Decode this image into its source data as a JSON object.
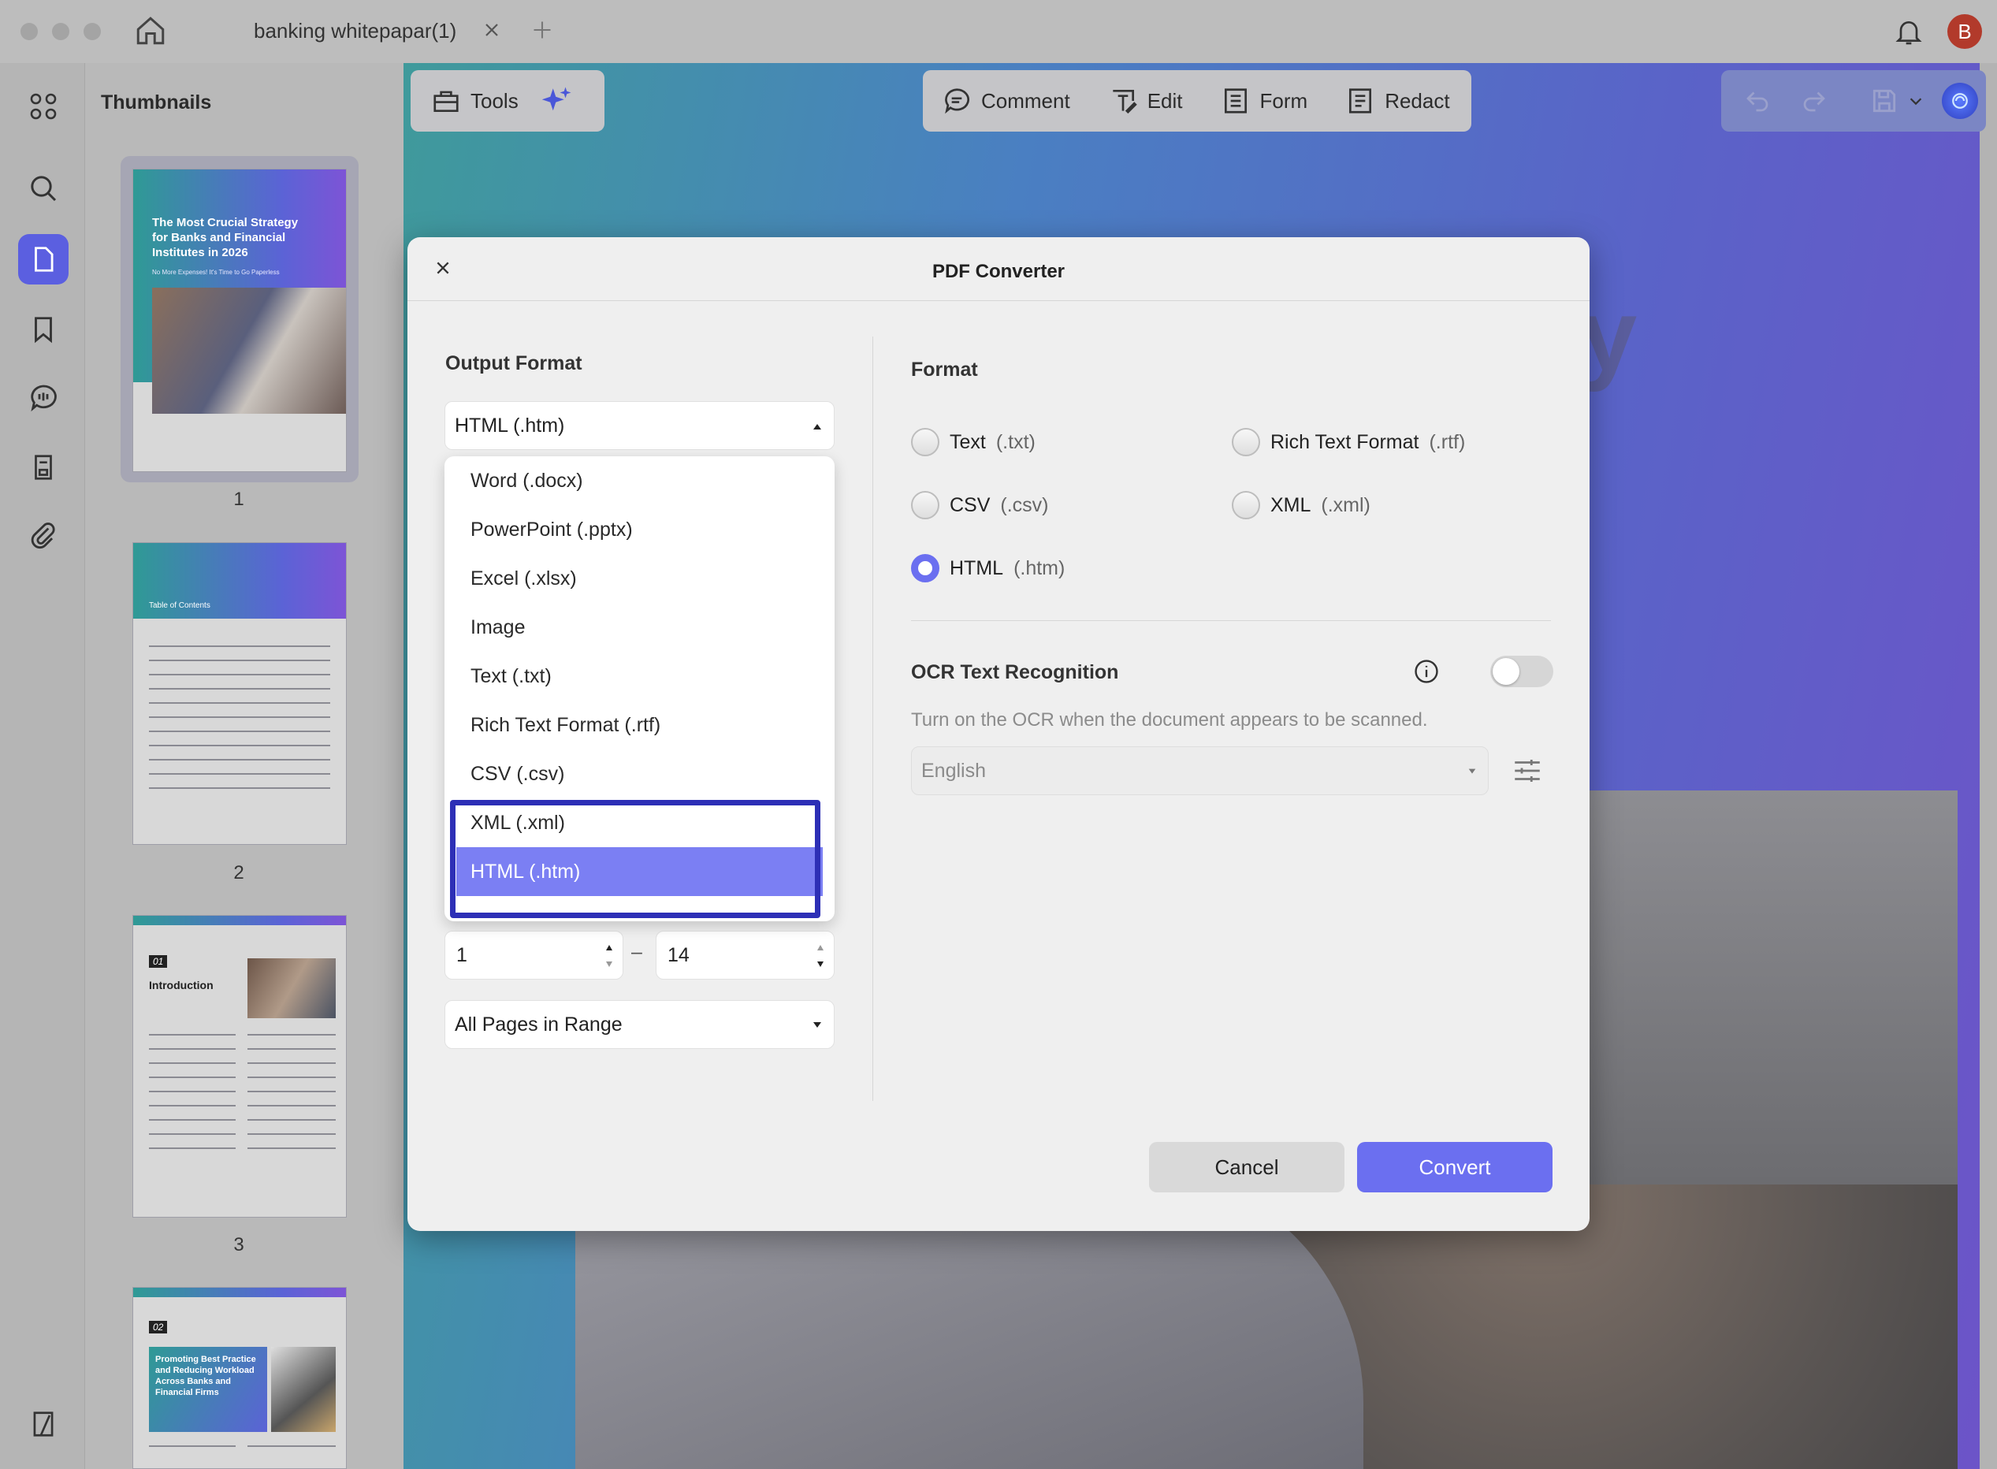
{
  "window": {
    "tab_title": "banking whitepapar(1)",
    "avatar_letter": "B",
    "accent": "#5b5fe0",
    "avatar_color": "#b23a2b"
  },
  "sidebar": {
    "panel_title": "Thumbnails",
    "icons": [
      "grid-icon",
      "search-icon",
      "page-icon",
      "bookmark-icon",
      "comment-icon",
      "form-icon",
      "attachment-icon"
    ],
    "bottom_icon": "sidebar-toggle-icon"
  },
  "thumbnails": [
    {
      "page": "1",
      "title": "The Most Crucial Strategy for Banks and Financial Institutes in 2026",
      "subtitle": "No More Expenses! It's Time to Go Paperless"
    },
    {
      "page": "2",
      "title": "Table of Contents"
    },
    {
      "page": "3",
      "chapter": "01",
      "title": "Introduction"
    },
    {
      "page": "",
      "chapter": "02",
      "title": "Promoting Best Practice and Reducing Workload Across Banks and Financial Firms"
    }
  ],
  "toolbar": {
    "tools_label": "Tools",
    "comment_label": "Comment",
    "edit_label": "Edit",
    "form_label": "Form",
    "redact_label": "Redact"
  },
  "page_bg_letter": "y",
  "dialog": {
    "title": "PDF Converter",
    "output_format_label": "Output Format",
    "output_format_value": "HTML (.htm)",
    "format_options": [
      {
        "label": "Word (.docx)",
        "selected": false
      },
      {
        "label": "PowerPoint (.pptx)",
        "selected": false
      },
      {
        "label": "Excel (.xlsx)",
        "selected": false
      },
      {
        "label": "Image",
        "selected": false
      },
      {
        "label": "Text (.txt)",
        "selected": false
      },
      {
        "label": "Rich Text Format (.rtf)",
        "selected": false
      },
      {
        "label": "CSV (.csv)",
        "selected": false
      },
      {
        "label": "XML (.xml)",
        "selected": false
      },
      {
        "label": "HTML (.htm)",
        "selected": true
      }
    ],
    "range_from": "1",
    "range_dash": "–",
    "range_to": "14",
    "page_subset": "All Pages in Range",
    "format_label": "Format",
    "radio_options": [
      {
        "name": "Text",
        "ext": "(.txt)",
        "checked": false
      },
      {
        "name": "Rich Text Format",
        "ext": "(.rtf)",
        "checked": false
      },
      {
        "name": "CSV",
        "ext": "(.csv)",
        "checked": false
      },
      {
        "name": "XML",
        "ext": "(.xml)",
        "checked": false
      },
      {
        "name": "HTML",
        "ext": "(.htm)",
        "checked": true
      }
    ],
    "ocr_label": "OCR Text Recognition",
    "ocr_enabled": false,
    "ocr_hint": "Turn on the OCR when the document appears to be scanned.",
    "ocr_language": "English",
    "cancel_label": "Cancel",
    "convert_label": "Convert",
    "convert_color": "#6b6ff0"
  }
}
